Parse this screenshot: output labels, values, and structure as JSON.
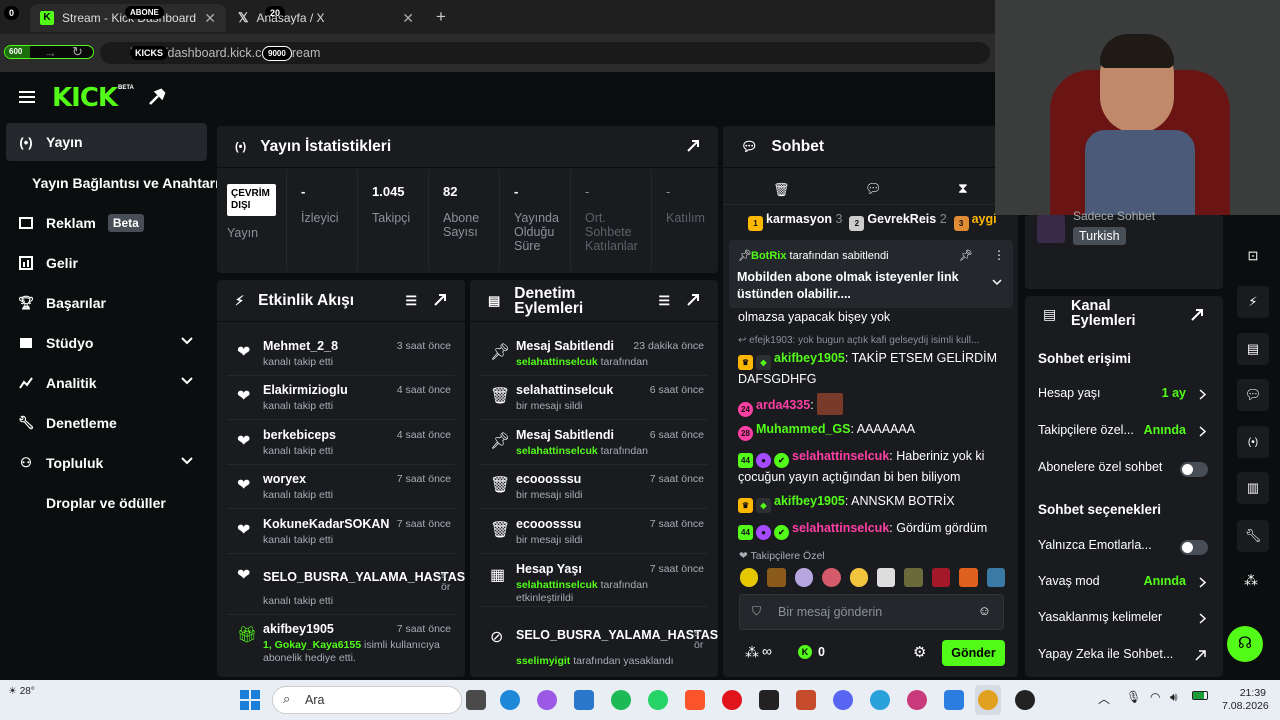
{
  "browser": {
    "tabs": [
      {
        "title": "Stream - Kick Dashboard"
      },
      {
        "title": "Anasayfa / X"
      }
    ],
    "url": "https://dashboard.kick.com/stream",
    "overlays": {
      "counter_left": "0",
      "abone_label": "ABONE",
      "abone_count": "20",
      "goal_left": "600",
      "kicks_label": "KICKS",
      "kicks_goal": "9000"
    }
  },
  "logo": {
    "text": "KICK",
    "beta": "BETA"
  },
  "sidebar": {
    "items": [
      {
        "label": "Yayın",
        "icon": "broadcast-icon"
      },
      {
        "label": "Yayın Bağlantısı ve Anahtarı"
      },
      {
        "label": "Reklam",
        "icon": "tv-icon",
        "badge": "Beta"
      },
      {
        "label": "Gelir",
        "icon": "chart-icon"
      },
      {
        "label": "Başarılar",
        "icon": "trophy-icon"
      },
      {
        "label": "Stüdyo",
        "icon": "studio-icon"
      },
      {
        "label": "Analitik",
        "icon": "analytics-icon"
      },
      {
        "label": "Denetleme",
        "icon": "wrench-icon"
      },
      {
        "label": "Topluluk",
        "icon": "community-icon"
      },
      {
        "label": "Droplar ve ödüller"
      }
    ]
  },
  "stats": {
    "title": "Yayın İstatistikleri",
    "status": "ÇEVRİM DIŞI",
    "status_label": "Yayın",
    "items": [
      {
        "value": "-",
        "label": "İzleyici"
      },
      {
        "value": "1.045",
        "label": "Takipçi"
      },
      {
        "value": "82",
        "label": "Abone Sayısı"
      },
      {
        "value": "-",
        "label": "Yayında Olduğu Süre"
      },
      {
        "value": "-",
        "label": "Ort. Sohbete Katılanlar"
      },
      {
        "value": "-",
        "label": "Katılım"
      }
    ]
  },
  "activity": {
    "title": "Etkinlik Akışı",
    "items": [
      {
        "name": "Mehmet_2_8",
        "sub": "kanalı takip etti",
        "time": "3 saat önce"
      },
      {
        "name": "Elakirmizioglu",
        "sub": "kanalı takip etti",
        "time": "4 saat önce"
      },
      {
        "name": "berkebiceps",
        "sub": "kanalı takip etti",
        "time": "4 saat önce"
      },
      {
        "name": "woryex",
        "sub": "kanalı takip etti",
        "time": "7 saat önce"
      },
      {
        "name": "KokuneKadarSOKAN",
        "sub": "kanalı takip etti",
        "time": "7 saat önce"
      },
      {
        "name": "SELO_BUSRA_YALAMA_HASTASI",
        "sub": "kanalı takip etti",
        "time": "s ör"
      },
      {
        "name": "akifbey1905",
        "sub_green": "1, Gokay_Kaya6155",
        "sub": "isimli kullanıcıya abonelik hediye etti.",
        "time": "7 saat önce"
      }
    ]
  },
  "moderation": {
    "title": "Denetim Eylemleri",
    "items": [
      {
        "name": "Mesaj Sabitlendi",
        "by": "selahattinselcuk",
        "sub": "tarafından",
        "time": "23 dakika önce"
      },
      {
        "name": "selahattinselcuk",
        "sub": "bir mesajı sildi",
        "time": "6 saat önce"
      },
      {
        "name": "Mesaj Sabitlendi",
        "by": "selahattinselcuk",
        "sub": "tarafından",
        "time": "6 saat önce"
      },
      {
        "name": "ecooosssu",
        "sub": "bir mesajı sildi",
        "time": "7 saat önce"
      },
      {
        "name": "ecooosssu",
        "sub": "bir mesajı sildi",
        "time": "7 saat önce"
      },
      {
        "name": "Hesap Yaşı",
        "by": "selahattinselcuk",
        "sub": "tarafından",
        "sub2": "etkinleştirildi",
        "time": "7 saat önce"
      },
      {
        "name": "SELO_BUSRA_YALAMA_HASTASI",
        "by": "sselimyigit",
        "sub": "tarafından yasaklandı",
        "time": "s ör"
      }
    ]
  },
  "chat": {
    "title": "Sohbet",
    "leaderboard": [
      {
        "rank": "1",
        "name": "karmasyon",
        "count": "3"
      },
      {
        "rank": "2",
        "name": "GevrekReis",
        "count": "2"
      },
      {
        "rank": "3",
        "name": "aygi"
      }
    ],
    "pinned": {
      "user": "BotRix",
      "suffix": "tarafından sabitlendi",
      "text": "Mobilden abone olmak isteyenler link üstünden olabilir...."
    },
    "messages": [
      {
        "text": "olmazsa yapacak bişey yok"
      },
      {
        "reply": "efejk1903: yok bugun açtık kafi gelseydij isimli kull..."
      },
      {
        "user": "akifbey1905",
        "color": "#53fc18",
        "text": "TAKİP ETSEM GELİRDİM DAFSGDHFG"
      },
      {
        "user": "arda4335",
        "color": "#ff3fa4",
        "badge": "24",
        "text": ""
      },
      {
        "user": "Muhammed_GS",
        "color": "#53fc18",
        "badge": "28",
        "text": "AAAAAAA"
      },
      {
        "user": "selahattinselcuk",
        "color": "#ff3fa4",
        "badge": "44",
        "text": "Haberiniz yok ki çocuğun yayın açtığından bi ben biliyom"
      },
      {
        "user": "akifbey1905",
        "color": "#53fc18",
        "text": "ANNSKM BOTRİX"
      },
      {
        "user": "selahattinselcuk",
        "color": "#ff3fa4",
        "badge": "44",
        "text": "Gördüm gördüm"
      }
    ],
    "emote_label": "Takipçilere Özel",
    "input_placeholder": "Bir mesaj gönderin",
    "kicks": "0",
    "send": "Gönder"
  },
  "right": {
    "chat_mode": "Sadece Sohbet",
    "language": "Turkish",
    "channel_actions": "Kanal Eylemleri",
    "chat_access": "Sohbet erişimi",
    "account_age": {
      "label": "Hesap yaşı",
      "value": "1 ay"
    },
    "followers_only": {
      "label": "Takipçilere özel...",
      "value": "Anında"
    },
    "subs_only": "Abonelere özel sohbet",
    "chat_options": "Sohbet seçenekleri",
    "emotes_only": "Yalnızca Emotlarla...",
    "slow_mode": {
      "label": "Yavaş mod",
      "value": "Anında"
    },
    "banned_words": "Yasaklanmış kelimeler",
    "ai": "Yapay Zeka ile Sohbet..."
  },
  "taskbar": {
    "weather": "28°",
    "search": "Ara",
    "time": "21:39",
    "date": "7.08.2026"
  },
  "colors": {
    "accent": "#53fc18",
    "panel": "#191b1f",
    "bg": "#0b0e0f"
  }
}
